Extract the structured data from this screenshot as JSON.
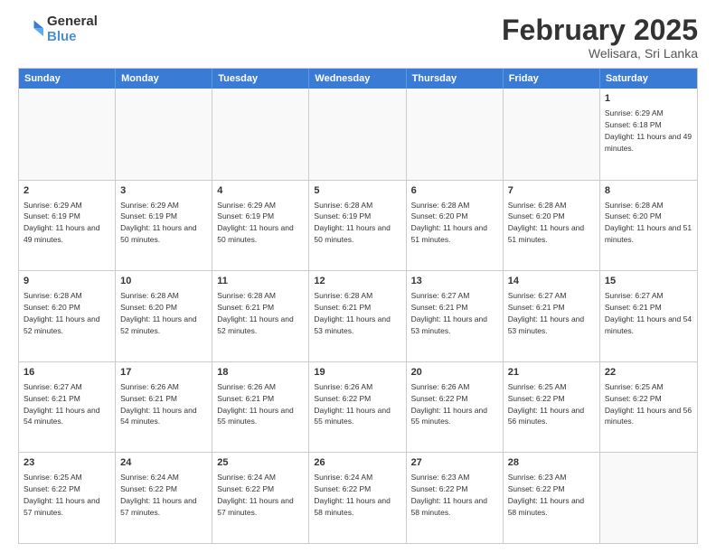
{
  "logo": {
    "general": "General",
    "blue": "Blue"
  },
  "header": {
    "month": "February 2025",
    "location": "Welisara, Sri Lanka"
  },
  "weekdays": [
    "Sunday",
    "Monday",
    "Tuesday",
    "Wednesday",
    "Thursday",
    "Friday",
    "Saturday"
  ],
  "rows": [
    [
      {
        "day": "",
        "info": "",
        "empty": true
      },
      {
        "day": "",
        "info": "",
        "empty": true
      },
      {
        "day": "",
        "info": "",
        "empty": true
      },
      {
        "day": "",
        "info": "",
        "empty": true
      },
      {
        "day": "",
        "info": "",
        "empty": true
      },
      {
        "day": "",
        "info": "",
        "empty": true
      },
      {
        "day": "1",
        "info": "Sunrise: 6:29 AM\nSunset: 6:18 PM\nDaylight: 11 hours and 49 minutes.",
        "empty": false
      }
    ],
    [
      {
        "day": "2",
        "info": "Sunrise: 6:29 AM\nSunset: 6:19 PM\nDaylight: 11 hours and 49 minutes.",
        "empty": false
      },
      {
        "day": "3",
        "info": "Sunrise: 6:29 AM\nSunset: 6:19 PM\nDaylight: 11 hours and 50 minutes.",
        "empty": false
      },
      {
        "day": "4",
        "info": "Sunrise: 6:29 AM\nSunset: 6:19 PM\nDaylight: 11 hours and 50 minutes.",
        "empty": false
      },
      {
        "day": "5",
        "info": "Sunrise: 6:28 AM\nSunset: 6:19 PM\nDaylight: 11 hours and 50 minutes.",
        "empty": false
      },
      {
        "day": "6",
        "info": "Sunrise: 6:28 AM\nSunset: 6:20 PM\nDaylight: 11 hours and 51 minutes.",
        "empty": false
      },
      {
        "day": "7",
        "info": "Sunrise: 6:28 AM\nSunset: 6:20 PM\nDaylight: 11 hours and 51 minutes.",
        "empty": false
      },
      {
        "day": "8",
        "info": "Sunrise: 6:28 AM\nSunset: 6:20 PM\nDaylight: 11 hours and 51 minutes.",
        "empty": false
      }
    ],
    [
      {
        "day": "9",
        "info": "Sunrise: 6:28 AM\nSunset: 6:20 PM\nDaylight: 11 hours and 52 minutes.",
        "empty": false
      },
      {
        "day": "10",
        "info": "Sunrise: 6:28 AM\nSunset: 6:20 PM\nDaylight: 11 hours and 52 minutes.",
        "empty": false
      },
      {
        "day": "11",
        "info": "Sunrise: 6:28 AM\nSunset: 6:21 PM\nDaylight: 11 hours and 52 minutes.",
        "empty": false
      },
      {
        "day": "12",
        "info": "Sunrise: 6:28 AM\nSunset: 6:21 PM\nDaylight: 11 hours and 53 minutes.",
        "empty": false
      },
      {
        "day": "13",
        "info": "Sunrise: 6:27 AM\nSunset: 6:21 PM\nDaylight: 11 hours and 53 minutes.",
        "empty": false
      },
      {
        "day": "14",
        "info": "Sunrise: 6:27 AM\nSunset: 6:21 PM\nDaylight: 11 hours and 53 minutes.",
        "empty": false
      },
      {
        "day": "15",
        "info": "Sunrise: 6:27 AM\nSunset: 6:21 PM\nDaylight: 11 hours and 54 minutes.",
        "empty": false
      }
    ],
    [
      {
        "day": "16",
        "info": "Sunrise: 6:27 AM\nSunset: 6:21 PM\nDaylight: 11 hours and 54 minutes.",
        "empty": false
      },
      {
        "day": "17",
        "info": "Sunrise: 6:26 AM\nSunset: 6:21 PM\nDaylight: 11 hours and 54 minutes.",
        "empty": false
      },
      {
        "day": "18",
        "info": "Sunrise: 6:26 AM\nSunset: 6:21 PM\nDaylight: 11 hours and 55 minutes.",
        "empty": false
      },
      {
        "day": "19",
        "info": "Sunrise: 6:26 AM\nSunset: 6:22 PM\nDaylight: 11 hours and 55 minutes.",
        "empty": false
      },
      {
        "day": "20",
        "info": "Sunrise: 6:26 AM\nSunset: 6:22 PM\nDaylight: 11 hours and 55 minutes.",
        "empty": false
      },
      {
        "day": "21",
        "info": "Sunrise: 6:25 AM\nSunset: 6:22 PM\nDaylight: 11 hours and 56 minutes.",
        "empty": false
      },
      {
        "day": "22",
        "info": "Sunrise: 6:25 AM\nSunset: 6:22 PM\nDaylight: 11 hours and 56 minutes.",
        "empty": false
      }
    ],
    [
      {
        "day": "23",
        "info": "Sunrise: 6:25 AM\nSunset: 6:22 PM\nDaylight: 11 hours and 57 minutes.",
        "empty": false
      },
      {
        "day": "24",
        "info": "Sunrise: 6:24 AM\nSunset: 6:22 PM\nDaylight: 11 hours and 57 minutes.",
        "empty": false
      },
      {
        "day": "25",
        "info": "Sunrise: 6:24 AM\nSunset: 6:22 PM\nDaylight: 11 hours and 57 minutes.",
        "empty": false
      },
      {
        "day": "26",
        "info": "Sunrise: 6:24 AM\nSunset: 6:22 PM\nDaylight: 11 hours and 58 minutes.",
        "empty": false
      },
      {
        "day": "27",
        "info": "Sunrise: 6:23 AM\nSunset: 6:22 PM\nDaylight: 11 hours and 58 minutes.",
        "empty": false
      },
      {
        "day": "28",
        "info": "Sunrise: 6:23 AM\nSunset: 6:22 PM\nDaylight: 11 hours and 58 minutes.",
        "empty": false
      },
      {
        "day": "",
        "info": "",
        "empty": true
      }
    ]
  ]
}
